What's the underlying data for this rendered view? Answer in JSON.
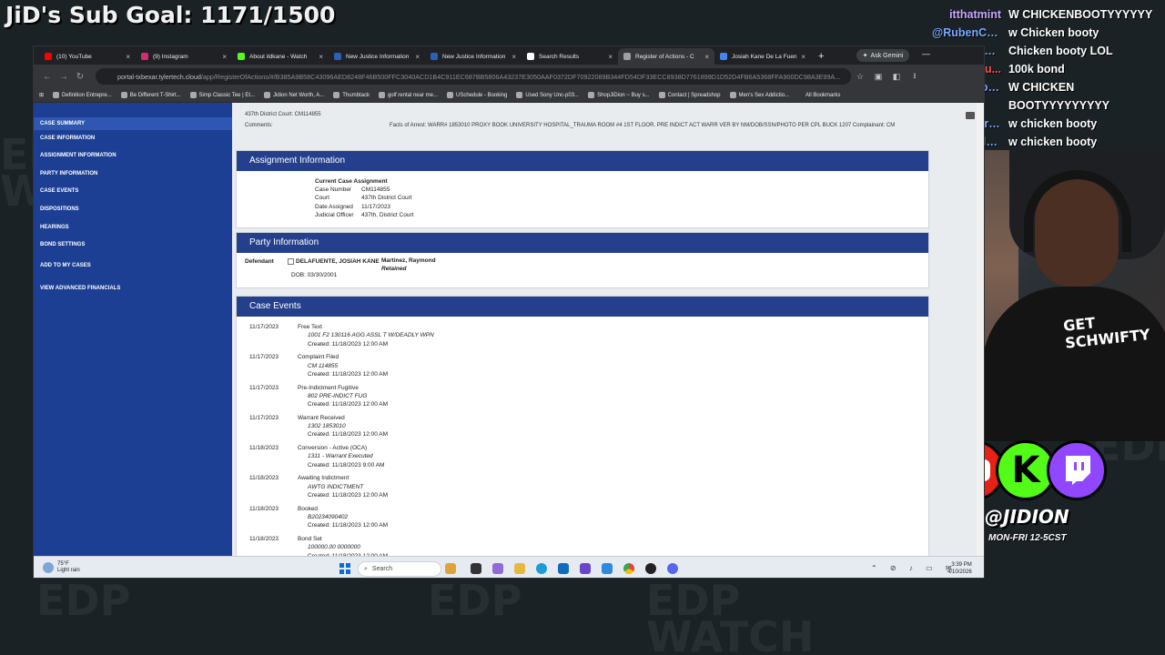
{
  "overlay": {
    "sub_goal": "JiD's Sub Goal: 1171/1500",
    "watermark": "EDP WATCH",
    "handle": "@JIDION",
    "schedule": "MON-FRI 12-5CST"
  },
  "chat": [
    {
      "user": "itthatmint",
      "text": "W CHICKENBOOTYYYYYY",
      "color": "#c8a8ff"
    },
    {
      "user": "@RubenCa...",
      "text": "w Chicken booty",
      "color": "#7aa7ff"
    },
    {
      "user": "@Flvtter_N...",
      "text": "Chicken booty LOL",
      "color": "#7aa7ff"
    },
    {
      "user": "...sou...",
      "text": "100k bond",
      "color": "#ff4d4d"
    },
    {
      "user": "@dumbhon...",
      "text": "W CHICKEN",
      "color": "#7aa7ff"
    },
    {
      "user": "",
      "text": "BOOTYYYYYYYYY",
      "color": "#7aa7ff"
    },
    {
      "user": "@resisterrest",
      "text": "w chicken booty",
      "color": "#7aa7ff"
    },
    {
      "user": "@neamydude",
      "text": "w chicken booty",
      "color": "#7aa7ff"
    }
  ],
  "webcam": {
    "shirt_text": "GET SCHWIFTY"
  },
  "browser": {
    "tabs": [
      {
        "title": "(10) YouTube",
        "fav": "#ff0000"
      },
      {
        "title": "(9) Instagram",
        "fav": "#d62976"
      },
      {
        "title": "About ildkane - Watch",
        "fav": "#53fc18"
      },
      {
        "title": "New Justice Information",
        "fav": "#2b5fb8"
      },
      {
        "title": "New Justice Information",
        "fav": "#2b5fb8"
      },
      {
        "title": "Search Results",
        "fav": "#ffffff"
      },
      {
        "title": "Register of Actions - C",
        "fav": "#9aa0a6",
        "active": true
      },
      {
        "title": "Josiah Kane De La Fuen",
        "fav": "#4285f4"
      }
    ],
    "new_tab": "+",
    "gemini": "Ask Gemini",
    "url_host": "portal-txbexar.tylertech.cloud",
    "url_path": "/app/RegisterOfActions/#/B385A9B58C43096AED8248F46B500FFC3040ACD1B4C911EC687BB5806A43237E3050AAF0372DF70922089B344FD54DF33ECC8938D7761899D1D52D4FB6A5368FFA900DC98A3E99A...",
    "bookmarks": [
      "Definition Entrepre...",
      "Be Different T-Shirt...",
      "Simp Classic Tee | Et...",
      "Jidion Net Worth, A...",
      "Thumbtack",
      "golf rental near me...",
      "USchedule - Booking",
      "Used Sony Unc-p03...",
      "ShopJiDion ~ Buy s...",
      "Contact | Spreadshop",
      "Men's Sex Addictio..."
    ],
    "all_bookmarks": "All Bookmarks"
  },
  "sidebar": {
    "items": [
      "CASE SUMMARY",
      "CASE INFORMATION",
      "ASSIGNMENT INFORMATION",
      "PARTY INFORMATION",
      "CASE EVENTS",
      "DISPOSITIONS",
      "HEARINGS",
      "BOND SETTINGS",
      "ADD TO MY CASES",
      "VIEW ADVANCED FINANCIALS"
    ]
  },
  "case": {
    "court_line": "437th District Court:   CM114855",
    "comments_label": "Comments:",
    "comments_value": "Facts of Arrest: WARR# 1853010 PROXY BOOK UNIVERSITY HOSPITAL_TRAUMA ROOM #4 1ST FLOOR. PRE INDICT ACT WARR VER BY NM/DOB/SSN/PHOTO PER CPL BUCK 1207 Complainant: CM"
  },
  "assignment": {
    "heading": "Assignment Information",
    "title": "Current Case Assignment",
    "rows": [
      {
        "k": "Case Number",
        "v": "CM114855"
      },
      {
        "k": "Court",
        "v": "437th District Court"
      },
      {
        "k": "Date Assigned",
        "v": "11/17/2023"
      },
      {
        "k": "Judicial Officer",
        "v": "437th, District Court"
      }
    ]
  },
  "party": {
    "heading": "Party Information",
    "label": "Defendant",
    "name": "DELAFUENTE, JOSIAH KANE",
    "dob": "DOB:   03/30/2001",
    "attorney": "Martinez, Raymond",
    "attorney_status": "Retained"
  },
  "events": {
    "heading": "Case Events",
    "items": [
      {
        "date": "11/17/2023",
        "title": "Free Text",
        "detail": "1001 F2 130116 AGG ASSL T W/DEADLY WPN",
        "created": "Created:   11/18/2023 12:00 AM"
      },
      {
        "date": "11/17/2023",
        "title": "Complaint Filed",
        "detail": "CM 114855",
        "created": "Created:   11/18/2023 12:00 AM"
      },
      {
        "date": "11/17/2023",
        "title": "Pre-Indictment Fugitive",
        "detail": "802 PRE-INDICT FUG",
        "created": "Created:   11/18/2023 12:00 AM"
      },
      {
        "date": "11/17/2023",
        "title": "Warrant Received",
        "detail": "1302 1853010",
        "created": "Created:   11/18/2023 12:00 AM"
      },
      {
        "date": "11/18/2023",
        "title": "Conversion - Active (OCA)",
        "detail": "1311 - Warrant Executed",
        "created": "Created:   11/18/2023 9:00 AM"
      },
      {
        "date": "11/18/2023",
        "title": "Awaiting Indictment",
        "detail": "AWTG INDICTMENT",
        "created": "Created:   11/18/2023 12:00 AM"
      },
      {
        "date": "11/18/2023",
        "title": "Booked",
        "detail": "B20234090402",
        "created": "Created:   11/18/2023 12:00 AM"
      },
      {
        "date": "11/18/2023",
        "title": "Bond Set",
        "detail": "100000.00 0000000",
        "created": "Created:   11/18/2023 12:00 AM"
      }
    ]
  },
  "taskbar": {
    "temp": "75°F",
    "weather": "Light rain",
    "search": "Search",
    "time": "3:39 PM",
    "date": "4/10/2026"
  }
}
